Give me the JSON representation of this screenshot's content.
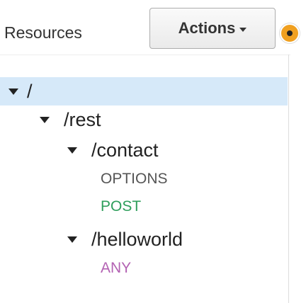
{
  "header": {
    "title": "Resources",
    "actions_label": "Actions"
  },
  "tree": {
    "root": {
      "label": "/"
    },
    "rest": {
      "label": "/rest"
    },
    "contact": {
      "label": "/contact",
      "methods": [
        {
          "label": "OPTIONS",
          "color": "#555555"
        },
        {
          "label": "POST",
          "color": "#2e9e5b"
        }
      ]
    },
    "helloworld": {
      "label": "/helloworld",
      "methods": [
        {
          "label": "ANY",
          "color": "#b362b3"
        }
      ]
    }
  },
  "colors": {
    "selected_row": "#d6e9f9",
    "status_dot": "#f0a020"
  },
  "icons": {
    "expand": "chevron-down-icon",
    "status": "status-dot-icon"
  }
}
